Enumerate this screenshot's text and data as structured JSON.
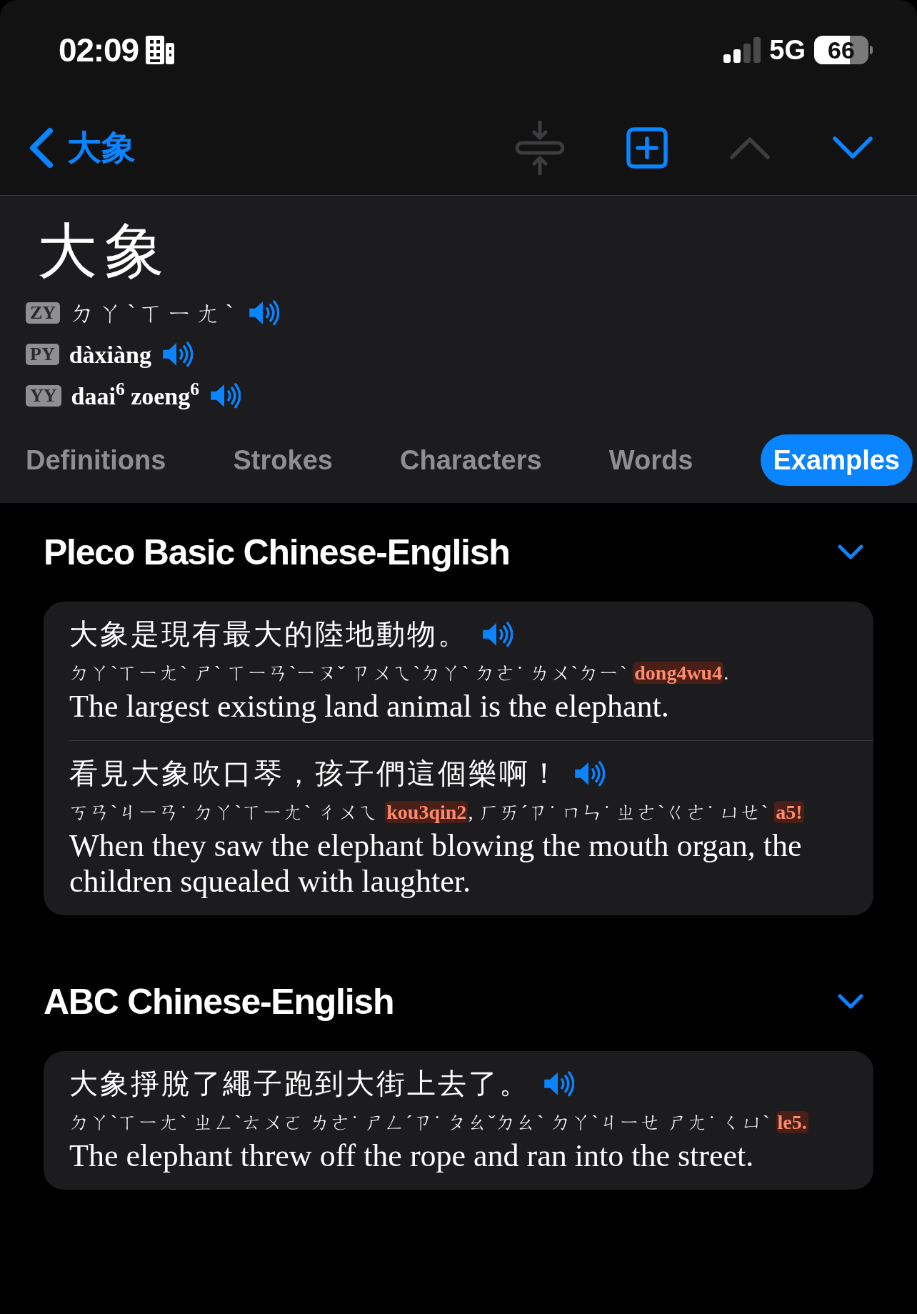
{
  "status_bar": {
    "time": "02:09",
    "network": "5G",
    "battery": "66"
  },
  "nav": {
    "back_label": "大象",
    "actions": [
      {
        "kind": "compress",
        "disabled": true
      },
      {
        "kind": "add",
        "disabled": false
      },
      {
        "kind": "previous",
        "disabled": true
      },
      {
        "kind": "next",
        "disabled": false
      }
    ]
  },
  "entry": {
    "headword": "大象",
    "readings": [
      {
        "tag": "ZY",
        "text": "ㄉㄚˋㄒㄧㄤˋ",
        "bold": false
      },
      {
        "tag": "PY",
        "text": "dàxiàng",
        "bold": true
      },
      {
        "tag": "YY",
        "text": "daai$^{6}$ zoeng$^{6}$",
        "bold": true
      }
    ]
  },
  "tabs": [
    {
      "label": "Definitions",
      "selected": false
    },
    {
      "label": "Strokes",
      "selected": false
    },
    {
      "label": "Characters",
      "selected": false
    },
    {
      "label": "Words",
      "selected": false
    },
    {
      "label": "Examples",
      "selected": true
    }
  ],
  "sections": [
    {
      "title": "Pleco Basic Chinese-English",
      "expanded": true,
      "examples": [
        {
          "chinese": "大象是現有最大的陸地動物。",
          "zhuyin": [
            {
              "text": "ㄉㄚˋㄒㄧㄤˋ ㄕˋ ㄒㄧㄢˋㄧㄡˇ ㄗㄨㄟˋㄉㄚˋ ㄉㄜ˙ ㄌㄨˋㄉㄧˋ ",
              "highlight": false
            },
            {
              "text": "dong4wu4",
              "highlight": true
            },
            {
              "text": ".",
              "highlight": false
            }
          ],
          "english": "The largest existing land animal is the elephant."
        },
        {
          "chinese": "看見大象吹口琴，孩子們這個樂啊！",
          "zhuyin": [
            {
              "text": "ㄎㄢˋㄐㄧㄢ˙ ㄉㄚˋㄒㄧㄤˋ ㄔㄨㄟ ",
              "highlight": false
            },
            {
              "text": "kou3qin2",
              "highlight": true
            },
            {
              "text": ", ㄏㄞˊㄗ˙ ㄇㄣ˙ ㄓㄜˋㄍㄜ˙ ㄩㄝˋ ",
              "highlight": false
            },
            {
              "text": "a5!",
              "highlight": true
            }
          ],
          "english": "When they saw the elephant blowing the mouth organ, the children squealed with laughter."
        }
      ]
    },
    {
      "title": "ABC Chinese-English",
      "expanded": true,
      "examples": [
        {
          "chinese": "大象掙脫了繩子跑到大街上去了。",
          "zhuyin": [
            {
              "text": "ㄉㄚˋㄒㄧㄤˋ ㄓㄥˋㄊㄨㄛ ㄌㄜ˙ ㄕㄥˊㄗ˙ ㄆㄠˇㄉㄠˋ ㄉㄚˋㄐㄧㄝ ㄕㄤ˙ ㄑㄩˋ ",
              "highlight": false
            },
            {
              "text": "le5.",
              "highlight": true
            }
          ],
          "english": "The elephant threw off the rope and ran into the street."
        }
      ]
    }
  ]
}
